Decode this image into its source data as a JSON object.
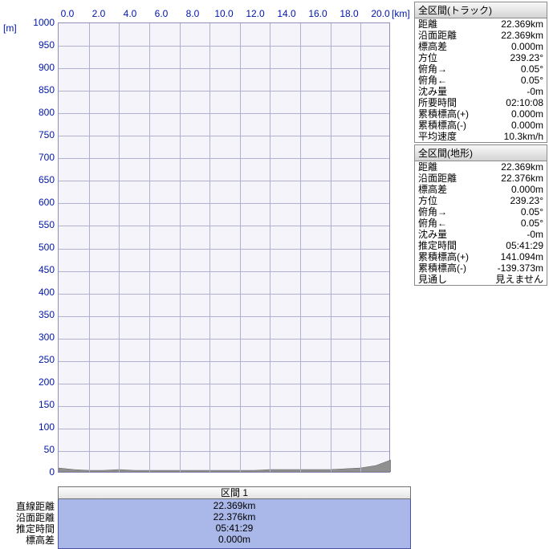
{
  "chart_data": {
    "type": "area",
    "title": "",
    "xlabel": "[km]",
    "ylabel": "[m]",
    "xlim": [
      0,
      22
    ],
    "ylim": [
      0,
      1000
    ],
    "x_ticks": [
      "0.0",
      "2.0",
      "4.0",
      "6.0",
      "8.0",
      "10.0",
      "12.0",
      "14.0",
      "16.0",
      "18.0",
      "20.0"
    ],
    "y_ticks": [
      "1000",
      "950",
      "900",
      "850",
      "800",
      "750",
      "700",
      "650",
      "600",
      "550",
      "500",
      "450",
      "400",
      "350",
      "300",
      "250",
      "200",
      "150",
      "100",
      "50",
      "0"
    ],
    "x": [
      0,
      1,
      2,
      3,
      4,
      5,
      6,
      7,
      8,
      9,
      10,
      11,
      12,
      13,
      14,
      15,
      16,
      17,
      18,
      19,
      20,
      21,
      22
    ],
    "values": [
      5,
      3,
      2,
      2,
      3,
      2,
      2,
      2,
      2,
      2,
      2,
      2,
      2,
      2,
      3,
      3,
      3,
      3,
      3,
      4,
      5,
      8,
      15
    ]
  },
  "y_unit": "[m]",
  "x_unit": "[km]",
  "section": {
    "header": "区間 1",
    "labels": [
      "直線距離",
      "沿面距離",
      "推定時間",
      "標高差"
    ],
    "values": [
      "22.369km",
      "22.376km",
      "05:41:29",
      "0.000m"
    ]
  },
  "panels": [
    {
      "title": "全区間(トラック)",
      "rows": [
        {
          "k": "距離",
          "v": "22.369km"
        },
        {
          "k": "沿面距離",
          "v": "22.369km"
        },
        {
          "k": "標高差",
          "v": "0.000m"
        },
        {
          "k": "方位",
          "v": "239.23°"
        },
        {
          "k": "俯角→",
          "v": "0.05°"
        },
        {
          "k": "俯角←",
          "v": "0.05°"
        },
        {
          "k": "沈み量",
          "v": "-0m"
        },
        {
          "k": "所要時間",
          "v": "02:10:08"
        },
        {
          "k": "累積標高(+)",
          "v": "0.000m"
        },
        {
          "k": "累積標高(-)",
          "v": "0.000m"
        },
        {
          "k": "平均速度",
          "v": "10.3km/h"
        }
      ]
    },
    {
      "title": "全区間(地形)",
      "rows": [
        {
          "k": "距離",
          "v": "22.369km"
        },
        {
          "k": "沿面距離",
          "v": "22.376km"
        },
        {
          "k": "標高差",
          "v": "0.000m"
        },
        {
          "k": "方位",
          "v": "239.23°"
        },
        {
          "k": "俯角→",
          "v": "0.05°"
        },
        {
          "k": "俯角←",
          "v": "0.05°"
        },
        {
          "k": "沈み量",
          "v": "-0m"
        },
        {
          "k": "推定時間",
          "v": "05:41:29"
        },
        {
          "k": "累積標高(+)",
          "v": "141.094m"
        },
        {
          "k": "累積標高(-)",
          "v": "-139.373m"
        },
        {
          "k": "見通し",
          "v": "見えません"
        }
      ]
    }
  ]
}
